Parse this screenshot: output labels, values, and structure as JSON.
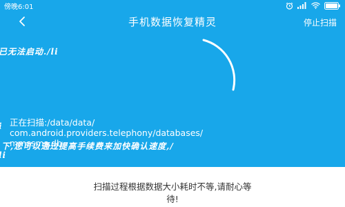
{
  "colors": {
    "background": "#18a7ea",
    "foreground": "#ffffff",
    "panel": "#ffffff",
    "panel_text": "#333333"
  },
  "status_bar": {
    "time": "傍晚6:01",
    "icons": [
      "alarm-icon",
      "signal-icon",
      "wifi-icon",
      "battery-icon"
    ]
  },
  "header": {
    "back_icon": "chevron-left-icon",
    "title": "手机数据恢复精灵",
    "stop_button": "停止扫描"
  },
  "scan": {
    "status_label": "正在扫描",
    "path_line1": ":/data/data/",
    "path_line2": "com.android.providers.telephony/databases/",
    "path_line3": "mmssms.db"
  },
  "overlay_text": {
    "line_a": "已无法启动./li",
    "line_b": "i",
    "line_c": "下,您可以通过提高手续费来加快确认速度,/",
    "line_d": "li"
  },
  "footer": {
    "line1": "扫描过程根据数据大小耗时不等,请耐心等",
    "line2": "待!"
  }
}
